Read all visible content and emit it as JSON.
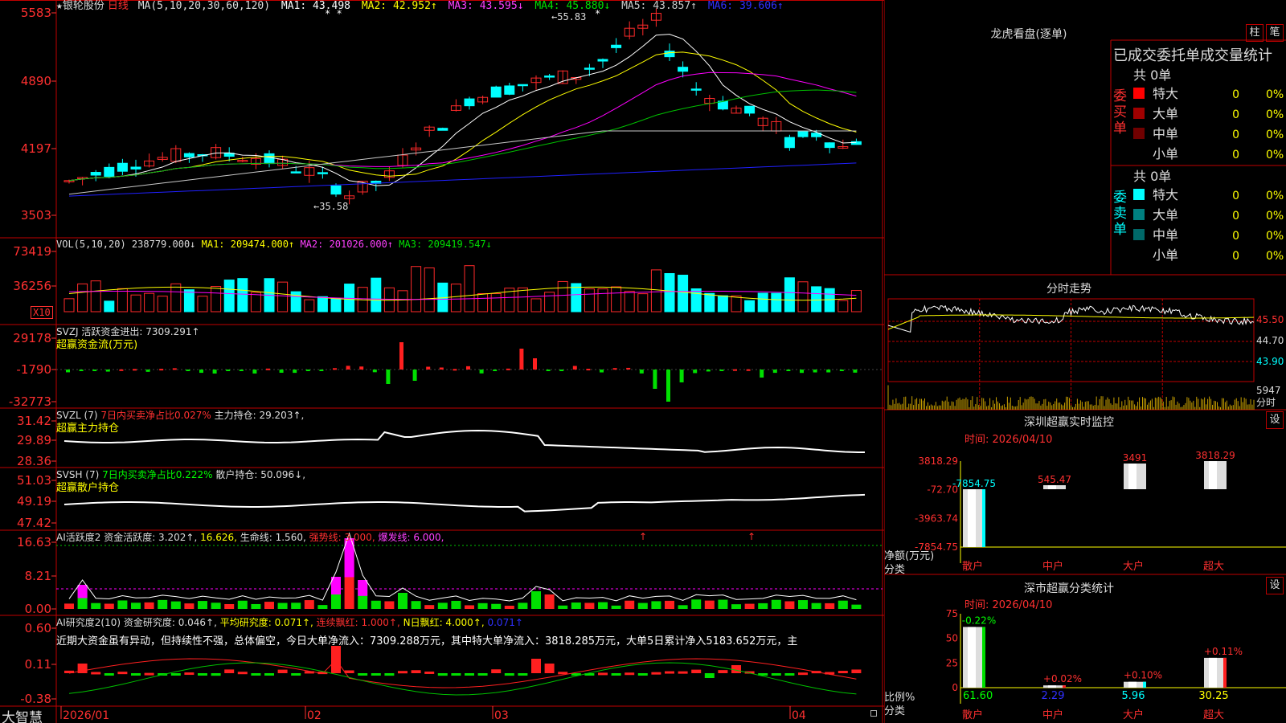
{
  "brand": "大智慧",
  "colors": {
    "up": "#ff2a2a",
    "down": "#00ffff",
    "grid": "#c00000",
    "ma1": "#ffffff",
    "ma2": "#ffff00",
    "ma3": "#ff00ff",
    "ma4": "#00c000",
    "ma5": "#c8c8c8",
    "ma6": "#2020ff"
  },
  "main": {
    "star": "★",
    "stock_name": "银轮股份",
    "period": "日线",
    "ma_label": "MA(5,10,20,30,60,120)",
    "ma1": "MA1: 43.498",
    "ma2": "MA2: 42.952↑",
    "ma3": "MA3: 43.595↓",
    "ma4": "MA4: 45.880↓",
    "ma5": "MA5: 43.857↑",
    "ma6": "MA6: 39.606↑",
    "high_mark": "←55.83",
    "low_mark": "←35.58",
    "y_ticks": [
      "5583",
      "4890",
      "4197",
      "3503"
    ],
    "stars": "* *"
  },
  "vol": {
    "title": "VOL(5,10,20) 238779.000↓",
    "ma1": "MA1: 209474.000↑",
    "ma2": "MA2: 201026.000↑",
    "ma3": "MA3: 209419.547↓",
    "y_ticks": [
      "73419",
      "36256"
    ],
    "unit": "X10"
  },
  "svzj": {
    "title": "SVZJ  活跃资金进出: 7309.291↑",
    "subtitle": "超赢资金流(万元)",
    "y_ticks": [
      "29178",
      "-1790",
      "-32773"
    ]
  },
  "svzl": {
    "title": "SVZL (7)",
    "ratio": "7日内买卖净占比0.027%",
    "hold": "主力持仓: 29.203↑,",
    "subtitle": "超赢主力持仓",
    "y_ticks": [
      "31.42",
      "29.89",
      "28.36"
    ]
  },
  "svsh": {
    "title": "SVSH (7)",
    "ratio": "7日内买卖净占比0.222%",
    "hold": "散户持仓: 50.096↓,",
    "subtitle": "超赢散户持仓",
    "y_ticks": [
      "51.03",
      "49.19",
      "47.42"
    ]
  },
  "ai1": {
    "title": "AI活跃度2 资金活跃度: 3.202↑,",
    "v2": "16.626,",
    "life": "生命线: 1.560,",
    "strong": "强势线: 3.000,",
    "burst": "爆发线: 6.000,",
    "y_ticks": [
      "16.63",
      "8.21",
      "0.00"
    ]
  },
  "ai2": {
    "title": "AI研究度2(10) 资金研究度: 0.046↑,",
    "avg": "平均研究度: 0.071↑,",
    "cont": "连续飘红: 1.000↑,",
    "nday": "N日飘红: 4.000↑,",
    "last": "0.071↑",
    "comment": "近期大资金虽有异动，但持续性不强，总体偏空，今日大单净流入：7309.288万元，其中特大单净流入：3818.285万元，大单5日累计净入5183.652万元，主",
    "y_ticks": [
      "0.60",
      "0.11",
      "-0.38"
    ]
  },
  "x_labels": [
    "2026/01",
    "02",
    "03",
    "04"
  ],
  "lhb": {
    "title": "龙虎看盘(逐单)",
    "btn1": "柱",
    "btn2": "笔",
    "header": "已成交委托单成交量统计",
    "buy_label": "委买单",
    "sell_label": "委卖单",
    "buy_total": "共 0单",
    "sell_total": "共 0单",
    "buy_rows": [
      {
        "name": "特大",
        "count": "0",
        "pct": "0%",
        "color": "#ff0000"
      },
      {
        "name": "大单",
        "count": "0",
        "pct": "0%",
        "color": "#a00000"
      },
      {
        "name": "中单",
        "count": "0",
        "pct": "0%",
        "color": "#700000"
      },
      {
        "name": "小单",
        "count": "0",
        "pct": "0%",
        "color": "#000000"
      }
    ],
    "sell_rows": [
      {
        "name": "特大",
        "count": "0",
        "pct": "0%",
        "color": "#00ffff"
      },
      {
        "name": "大单",
        "count": "0",
        "pct": "0%",
        "color": "#008080"
      },
      {
        "name": "中单",
        "count": "0",
        "pct": "0%",
        "color": "#006868"
      },
      {
        "name": "小单",
        "count": "0",
        "pct": "0%",
        "color": "#000000"
      }
    ]
  },
  "fenshi": {
    "title": "分时走势",
    "y_labels": [
      "45.50",
      "44.70",
      "43.90"
    ],
    "vol_label": "5947",
    "unit_label": "分时"
  },
  "sz_monitor": {
    "title": "深圳超赢实时监控",
    "btn": "设",
    "time": "时间: 2026/04/10",
    "y_ticks": [
      "3818.29",
      "-72.70",
      "-3963.74",
      "-7854.75"
    ],
    "axis_label": "净额(万元)",
    "cat_label": "分类",
    "categories": [
      "散户",
      "中户",
      "大户",
      "超大"
    ],
    "value_labels": [
      "-7854.75",
      "545.47",
      "3491",
      "3818.29"
    ]
  },
  "sz_class": {
    "title": "深市超赢分类统计",
    "btn": "设",
    "time": "时间: 2026/04/10",
    "y_ticks": [
      "75",
      "50",
      "25",
      "0"
    ],
    "axis_label": "比例%",
    "cat_label": "分类",
    "categories": [
      "散户",
      "中户",
      "大户",
      "超大"
    ],
    "pct_labels": [
      "-0.22%",
      "+0.02%",
      "+0.10%",
      "+0.11%"
    ],
    "bottom_values": [
      "61.60",
      "2.29",
      "5.96",
      "30.25"
    ]
  },
  "chart_data": [
    {
      "type": "bar",
      "title": "深圳超赢实时监控",
      "categories": [
        "散户",
        "中户",
        "大户",
        "超大"
      ],
      "values": [
        -7854.75,
        545.47,
        3491,
        3818.29
      ],
      "ylabel": "净额(万元)",
      "ylim": [
        -7854.75,
        3818.29
      ]
    },
    {
      "type": "bar",
      "title": "深市超赢分类统计",
      "categories": [
        "散户",
        "中户",
        "大户",
        "超大"
      ],
      "values": [
        61.6,
        2.29,
        5.96,
        30.25
      ],
      "ylabel": "比例%",
      "ylim": [
        0,
        75
      ]
    }
  ]
}
